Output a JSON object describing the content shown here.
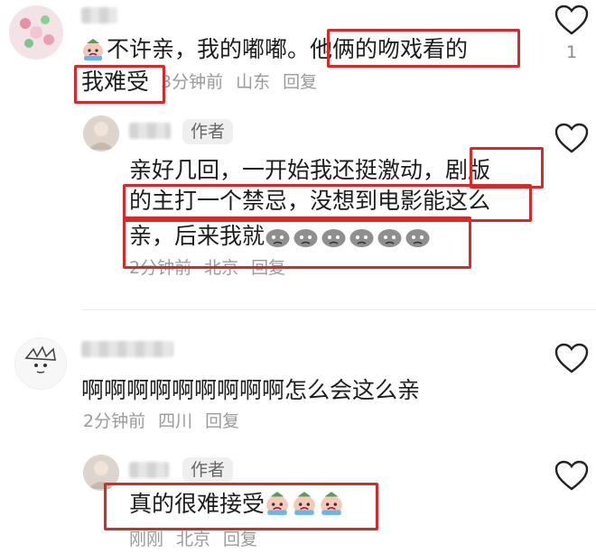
{
  "comments": [
    {
      "text_a": "不许亲，我的嘟嘟。",
      "text_b": "他俩的吻戏看的",
      "text_c": "我难受",
      "time": "3分钟前",
      "location": "山东",
      "reply_label": "回复",
      "like_count": "1",
      "reply": {
        "author_badge": "作者",
        "line1_a": "亲好几回，一开始我还挺激动，",
        "line1_b": "剧版",
        "line2": "的主打一个禁忌，没想到电影能这么",
        "line3": "亲，后来我就",
        "time": "2分钟前",
        "location": "北京",
        "reply_label": "回复"
      }
    },
    {
      "text": "啊啊啊啊啊啊啊啊啊怎么会这么亲",
      "time": "2分钟前",
      "location": "四川",
      "reply_label": "回复",
      "reply": {
        "author_badge": "作者",
        "text": "真的很难接受",
        "time": "刚刚",
        "location": "北京",
        "reply_label": "回复"
      }
    }
  ],
  "icons": {
    "like": "heart-outline-icon",
    "crying": "crying-face-emoji",
    "sad": "sad-grey-face-emoji"
  },
  "colors": {
    "highlight": "#d62a2a",
    "meta": "#9a9a9a"
  }
}
